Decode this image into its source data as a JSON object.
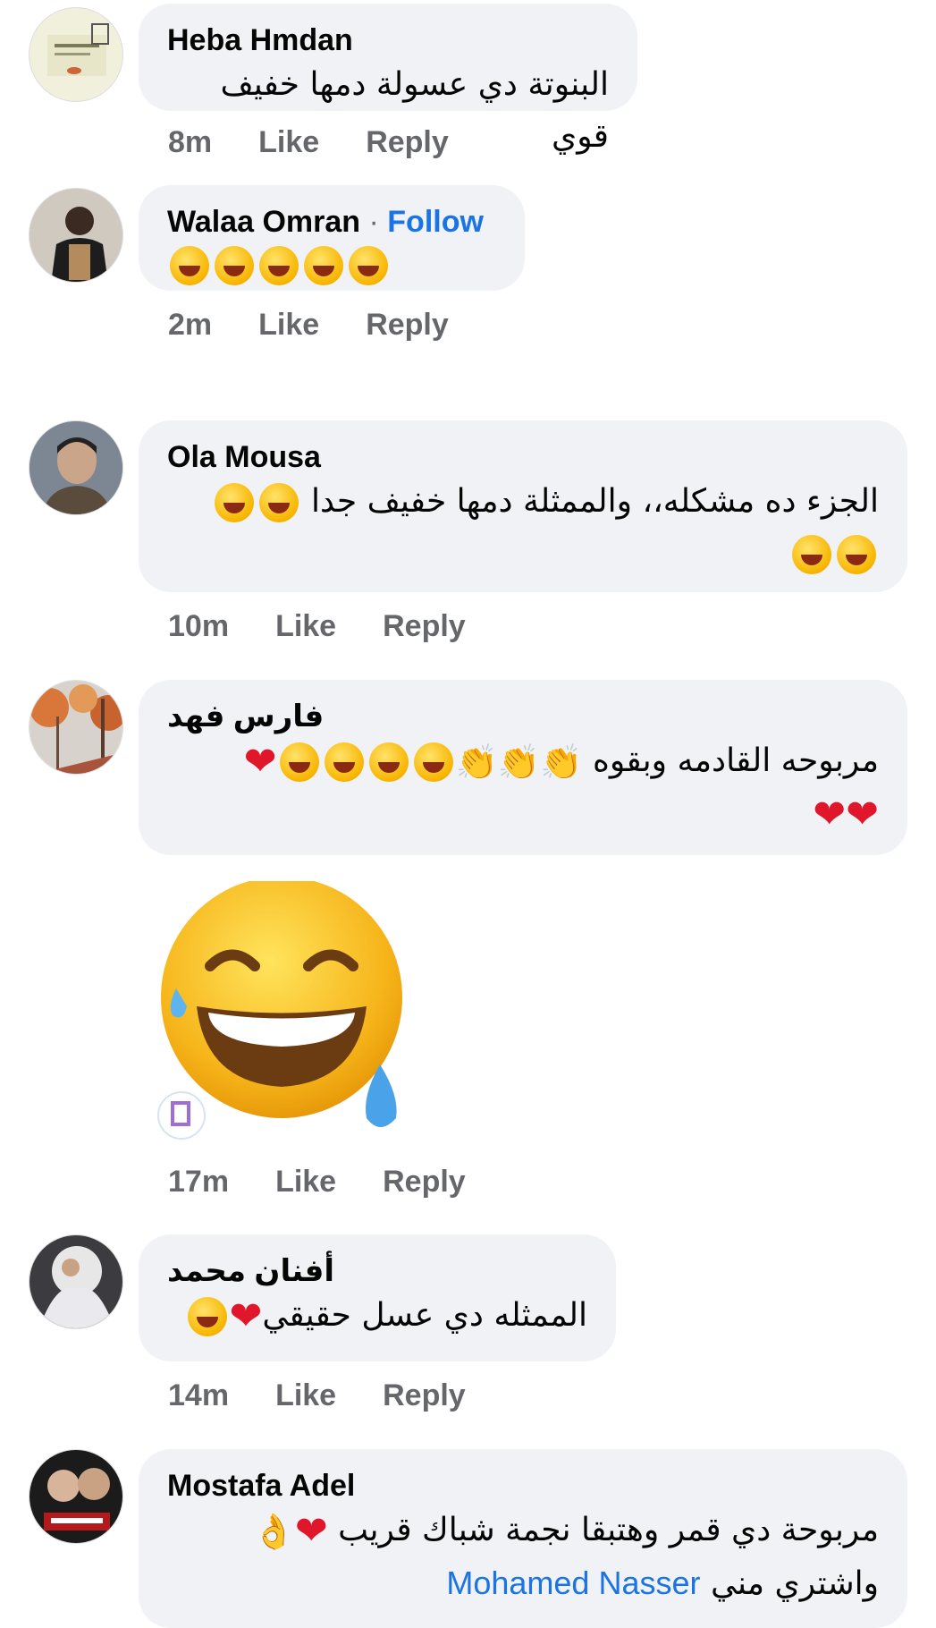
{
  "comments": [
    {
      "name": "Heba Hmdan",
      "text": "البنوتة دي عسولة دمها خفيف قوي",
      "time": "8m",
      "like": "Like",
      "reply": "Reply"
    },
    {
      "name": "Walaa Omran",
      "separator": "·",
      "follow": "Follow",
      "emojis": [
        "rofl-emoji",
        "rofl-emoji",
        "rofl-emoji",
        "rofl-emoji",
        "rofl-emoji"
      ],
      "time": "2m",
      "like": "Like",
      "reply": "Reply"
    },
    {
      "name": "Ola Mousa",
      "text": "الجزء ده مشكله،، والممثلة دمها خفيف جدا",
      "time": "10m",
      "like": "Like",
      "reply": "Reply"
    },
    {
      "name": "فارس فهد",
      "text": "مربوحه القادمه وبقوه",
      "time": "17m",
      "like": "Like",
      "reply": "Reply"
    },
    {
      "name": "أفنان محمد",
      "text": "الممثله دي عسل حقيقي",
      "time": "14m",
      "like": "Like",
      "reply": "Reply"
    },
    {
      "name": "Mostafa Adel",
      "text_line1": "مربوحة دي قمر وهتبقا نجمة شباك قريب",
      "text_line2": "واشتري مني",
      "mention": "Mohamed Nasser"
    }
  ],
  "sticker": {
    "icon": "laughing-tears-sticker"
  },
  "colors": {
    "bubble": "#f0f2f5",
    "meta": "#65676b",
    "link": "#1b74e4",
    "heart": "#e0162b"
  }
}
